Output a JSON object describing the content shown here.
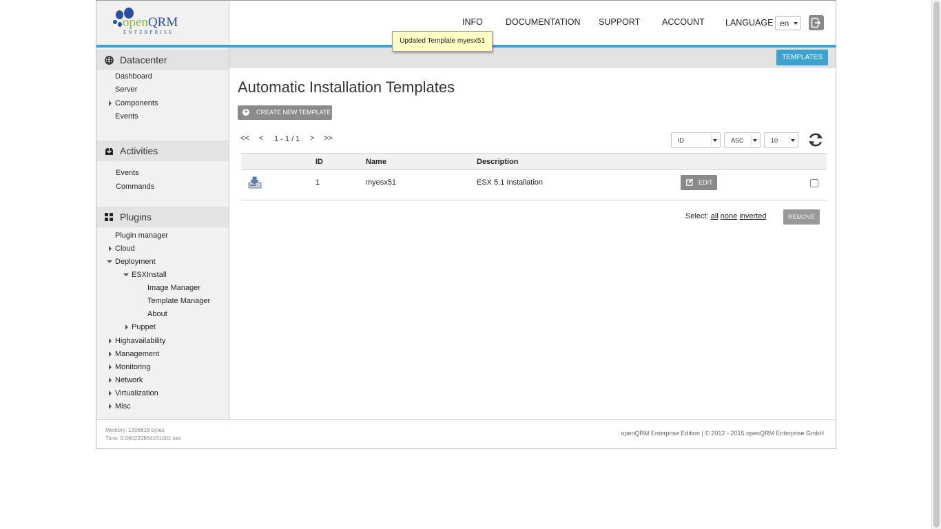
{
  "logo": {
    "brand_open": "open",
    "brand_qrm": "QRM",
    "brand_sub": "ENTERPRISE"
  },
  "topnav": {
    "info": "INFO",
    "documentation": "DOCUMENTATION",
    "support": "SUPPORT",
    "account": "ACCOUNT",
    "language_label": "LANGUAGE",
    "language_value": "en"
  },
  "tooltip": "Updated Template myesx51",
  "tab": {
    "templates": "TEMPLATES"
  },
  "sidebar": {
    "datacenter": {
      "title": "Datacenter",
      "items": [
        "Dashboard",
        "Server",
        "Components",
        "Events"
      ]
    },
    "activities": {
      "title": "Activities",
      "items": [
        "Events",
        "Commands"
      ]
    },
    "plugins": {
      "title": "Plugins",
      "items": [
        "Plugin manager",
        "Cloud",
        "Deployment",
        "ESXInstall",
        "Image Manager",
        "Template Manager",
        "About",
        "Puppet",
        "Highavailability",
        "Management",
        "Monitoring",
        "Network",
        "Virtualization",
        "Misc"
      ]
    }
  },
  "main": {
    "title": "Automatic Installation Templates",
    "create_button": "CREATE NEW TEMPLATE",
    "pager": {
      "first": "<<",
      "prev": "<",
      "range": "1 - 1 / 1",
      "next": ">",
      "last": ">>"
    },
    "sort_field": "ID",
    "sort_order": "ASC",
    "per_page": "10",
    "columns": {
      "id": "ID",
      "name": "Name",
      "description": "Description"
    },
    "rows": [
      {
        "id": "1",
        "name": "myesx51",
        "description": "ESX 5.1 Installation",
        "edit": "EDIT"
      }
    ],
    "select_label": "Select:",
    "select_all": "all",
    "select_none": "none",
    "select_inverted": "inverted",
    "remove_button": "REMOVE"
  },
  "footer": {
    "memory": "Memory: 1306616 bytes",
    "time": "Time: 0.060222864151001 sec",
    "copyright": "openQRM Enterprise Edition | © 2012 - 2015 openQRM Enterprise GmbH"
  },
  "colors": {
    "accent": "#3ba3d0",
    "brand_blue": "#2a4fa0",
    "brand_green": "#8fb73e",
    "tooltip_bg": "#ffffc5"
  }
}
